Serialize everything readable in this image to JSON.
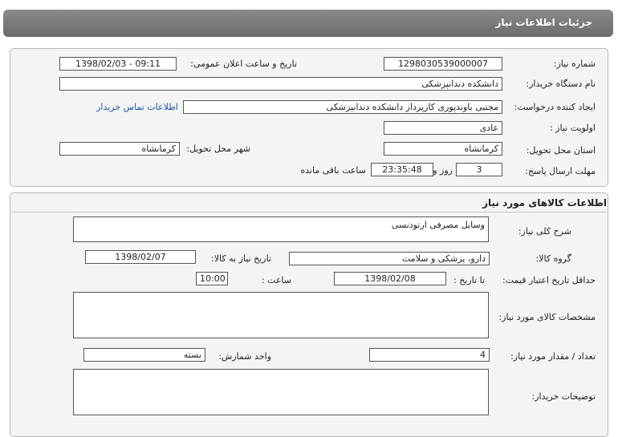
{
  "page_title": "جزئیات اطلاعات نیاز",
  "info": {
    "need_number_label": "شماره نیاز:",
    "need_number": "1298030539000007",
    "announce_label": "تاریخ و ساعت اعلان عمومی:",
    "announce_value": "1398/02/03 - 09:11",
    "buyer_label": "نام دستگاه خریدار:",
    "buyer_value": "دانشکده دندانپزشکی",
    "creator_label": "ایجاد کننده درخواست:",
    "creator_value": "مجتبی  باوندپوری کارپرداز دانشکده دندانپزشکی",
    "contact_link": "اطلاعات تماس خریدار",
    "priority_label": "اولویت نیاز :",
    "priority_value": "عادی",
    "province_label": "استان محل تحویل:",
    "province_value": "کرمانشاه",
    "city_label": "شهر محل تحویل:",
    "city_value": "کرمانشاه",
    "deadline_label": "مهلت ارسال پاسخ:",
    "days_value": "3",
    "days_and_label": "روز و",
    "time_value": "23:35:48",
    "remaining_label": "ساعت باقی مانده"
  },
  "goods": {
    "section_title": "اطلاعات کالاهای مورد نیاز",
    "summary_label": "شرح کلی نیاز:",
    "summary_value": "وسایل مصرفی ارتودنسی",
    "group_label": "گروه کالا:",
    "group_value": "دارو، پزشکی و سلامت",
    "need_date_label": "تاریخ نیاز به کالا:",
    "need_date_value": "1398/02/07",
    "validity_label": "حداقل تاریخ اعتبار قیمت:",
    "to_date_label": "تا تاریخ :",
    "validity_date": "1398/02/08",
    "hour_label": "ساعت :",
    "validity_time": "10:00",
    "specs_label": "مشخصات کالای مورد نیاز:",
    "specs_value": "",
    "qty_label": "تعداد / مقدار مورد نیاز:",
    "qty_value": "4",
    "unit_label": "واحد شمارش:",
    "unit_value": "بسته",
    "desc_label": "توضیحات خریدار:",
    "desc_value": ""
  }
}
